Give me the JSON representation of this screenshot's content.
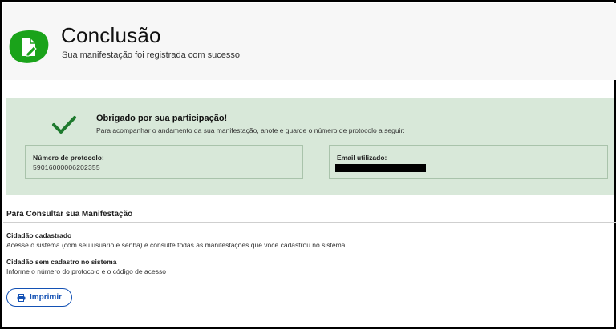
{
  "header": {
    "title": "Conclusão",
    "subtitle": "Sua manifestação foi registrada com sucesso",
    "logo_icon": "document-edit-icon",
    "logo_color": "#1aa31a"
  },
  "success": {
    "icon": "checkmark-icon",
    "accent": "#1e7a2e",
    "title": "Obrigado por sua participação!",
    "text": "Para acompanhar o andamento da sua manifestação, anote e guarde o número de protocolo a seguir:",
    "protocol_label": "Número de protocolo:",
    "protocol_value": "59016000006202355",
    "email_label": "Email utilizado:"
  },
  "consult": {
    "title": "Para Consultar sua Manifestação",
    "items": [
      {
        "title": "Cidadão cadastrado",
        "text": "Acesse o sistema (com seu usuário e senha) e consulte todas as manifestações que você cadastrou no sistema"
      },
      {
        "title": "Cidadão sem cadastro no sistema",
        "text": "Informe o número do protocolo e o código de acesso"
      }
    ]
  },
  "print_button": {
    "label": "Imprimir",
    "icon": "printer-icon",
    "color": "#1351b4"
  }
}
